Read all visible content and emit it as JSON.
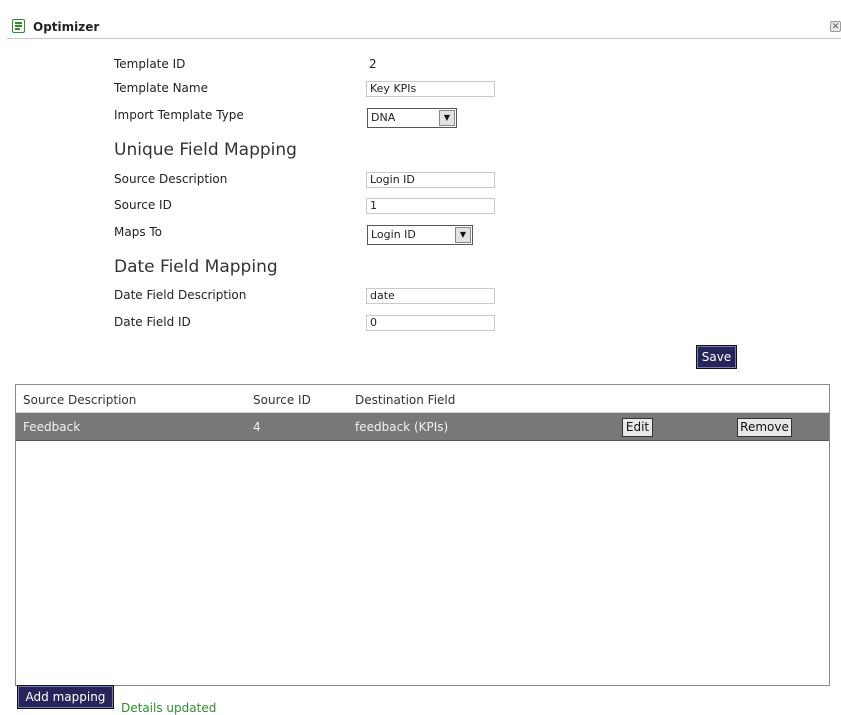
{
  "window": {
    "title": "Optimizer",
    "close_glyph": "✕"
  },
  "form": {
    "template_id_label": "Template ID",
    "template_id_value": "2",
    "template_name_label": "Template Name",
    "template_name_value": "Key KPIs",
    "import_type_label": "Import Template Type",
    "import_type_value": "DNA",
    "unique_section_title": "Unique Field Mapping",
    "source_description_label": "Source Description",
    "source_description_value": "Login ID",
    "source_id_label": "Source ID",
    "source_id_value": "1",
    "maps_to_label": "Maps To",
    "maps_to_value": "Login ID",
    "date_section_title": "Date Field Mapping",
    "date_description_label": "Date Field Description",
    "date_description_value": "date",
    "date_id_label": "Date Field ID",
    "date_id_value": "0",
    "save_label": "Save"
  },
  "mappings": {
    "columns": [
      "Source Description",
      "Source ID",
      "Destination Field"
    ],
    "rows": [
      {
        "source_description": "Feedback",
        "source_id": "4",
        "destination_field": "feedback (KPIs)",
        "edit_label": "Edit",
        "remove_label": "Remove"
      }
    ]
  },
  "footer": {
    "add_mapping_label": "Add mapping",
    "status_text": "Details updated"
  },
  "icons": {
    "title": "form-icon",
    "close": "close-icon",
    "dropdown": "chevron-down-icon"
  },
  "colors": {
    "button_dark": "#25255c",
    "row_selected": "#787878",
    "status_green": "#2f8f2f"
  }
}
